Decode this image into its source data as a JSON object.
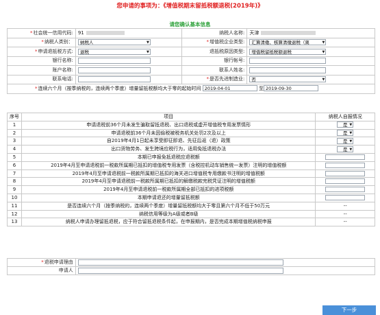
{
  "title": "您申请的事项为：《增值税期末留抵税额退税(2019年)》",
  "subtitle": "请您确认基本信息",
  "basic_info": {
    "credit_code_label": "社会统一信用代码:",
    "credit_code_value": "91",
    "taxpayer_name_label": "纳税人名称:",
    "taxpayer_name_value": "天津",
    "taxpayer_type_label": "纳税人类别：",
    "taxpayer_type_value": "纳税人",
    "vat_enterprise_type_label": "增值税企业类型:",
    "vat_enterprise_type_value": "汇算清缴、核算清缴退税（离",
    "refund_method_label": "申请退抵税方式:",
    "refund_method_value": "退税",
    "refund_reason_label": "退抵税原因类型:",
    "refund_reason_value": "增值税留抵税额退税",
    "bank_name_label": "银行名称:",
    "bank_name_value": "",
    "bank_account_label": "银行帐号:",
    "bank_account_value": "",
    "account_name_label": "账户名称:",
    "account_name_value": "",
    "contact_name_label": "联系人姓名:",
    "contact_name_value": "",
    "contact_phone_label": "联系电话:",
    "contact_phone_value": "",
    "advanced_mfg_label": "是否先进制造业:",
    "advanced_mfg_value": "否",
    "period_label": "连续六个月（按季纳税的，连续两个季度）增量留抵税额均大于零的起始时间",
    "period_start": "2019-04-01",
    "period_to": "至",
    "period_end": "2019-09-30"
  },
  "items_header": {
    "no": "序号",
    "item": "项目",
    "report": "纳税人自报情况"
  },
  "items": [
    {
      "no": "1",
      "text": "申请退税前36个月未发生骗取留抵退税、出口退税或虚开增值税专用发票情形",
      "kind": "select",
      "value": "是"
    },
    {
      "no": "2",
      "text": "申请退税前36个月未因偷税被税务机关处罚2次及以上",
      "kind": "select",
      "value": "是"
    },
    {
      "no": "3",
      "text": "自2019年4月1日起未享受即征即退、先征后返（退）政策",
      "kind": "select",
      "value": "是"
    },
    {
      "no": "4",
      "text": "出口货物劳务、发生跨境应税行为，适用免抵退税办法",
      "kind": "select",
      "value": "是"
    },
    {
      "no": "5",
      "text": "本期已申报免抵退税应退税额",
      "kind": "input",
      "value": ""
    },
    {
      "no": "6",
      "text": "2019年4月至申请退税前一税款所属期已抵扣的增值税专用发票（含税控机动车销售统一发票）注明的增值税额",
      "kind": "input",
      "value": ""
    },
    {
      "no": "7",
      "text": "2019年4月至申请退税前一税款所属期已抵扣的海关进口增值税专用缴款书注明的增值税额",
      "kind": "input",
      "value": ""
    },
    {
      "no": "8",
      "text": "2019年4月至申请退税前一税款所属期已抵扣的解缴税款完税凭证注明的增值税额",
      "kind": "input",
      "value": ""
    },
    {
      "no": "9",
      "text": "2019年4月至申请退税前一税款所属期全部已抵扣的进项税额",
      "kind": "input",
      "value": ""
    },
    {
      "no": "10",
      "text": "本期申请退还的增量留抵税额",
      "kind": "input",
      "value": ""
    },
    {
      "no": "11",
      "text": "是否连续六个月（按季纳税的，连续两个季度）增量留抵税额均大于零且第六个月不低于50万元",
      "kind": "text",
      "value": "--"
    },
    {
      "no": "12",
      "text": "纳税信用等级为A级或者B级",
      "kind": "text",
      "value": "--"
    },
    {
      "no": "13",
      "text": "纳税人申请办理留抵退税，应于符合留抵退税条件起，在申报期内，是否完成本期增值税纳税申报",
      "kind": "text",
      "value": "--"
    }
  ],
  "footer": {
    "refund_reason_label": "退税申请理由",
    "refund_reason_value": "",
    "applicant_label": "申请人",
    "applicant_value": ""
  },
  "next_button": "下一步",
  "colors": {
    "title": "#e02020",
    "subtitle": "#2aa037",
    "button": "#4a90d9"
  }
}
